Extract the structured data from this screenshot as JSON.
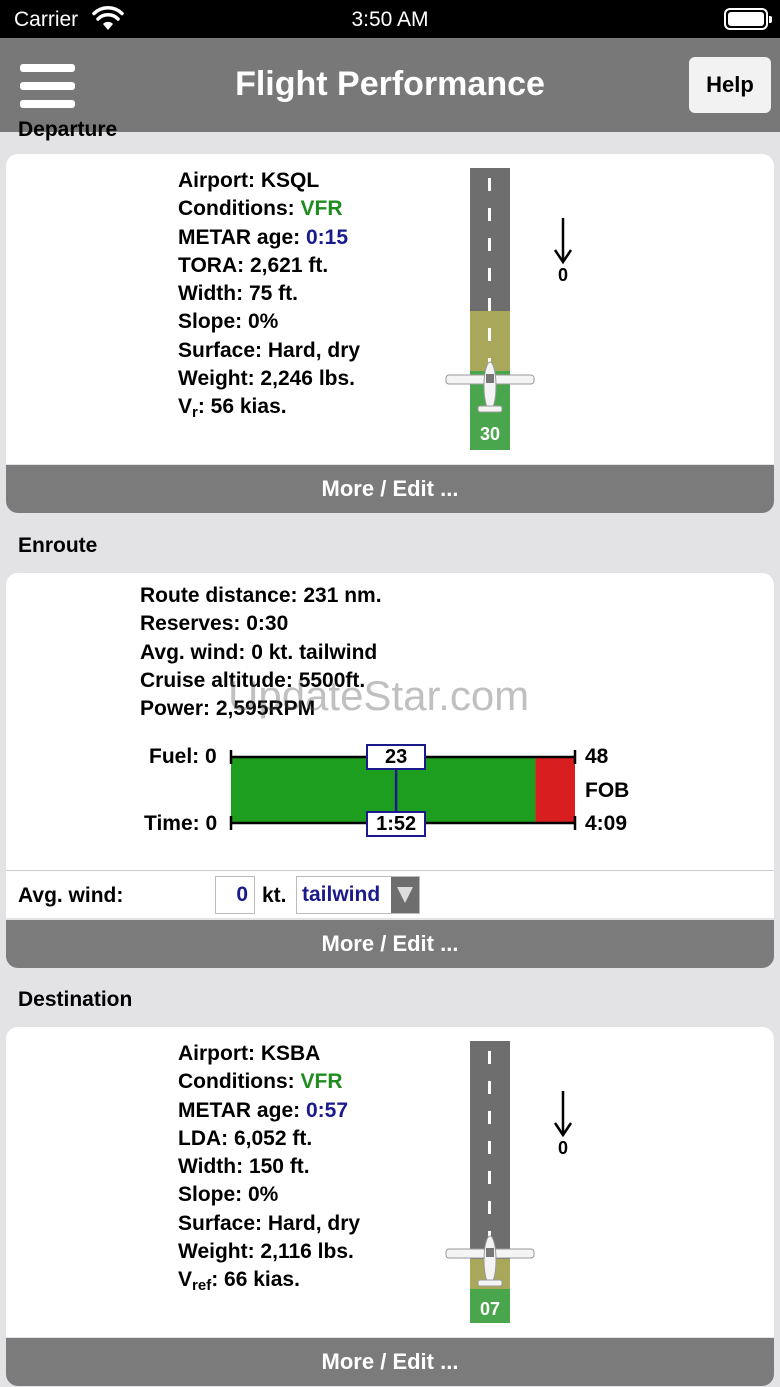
{
  "status_bar": {
    "carrier": "Carrier",
    "time": "3:50 AM"
  },
  "nav": {
    "title": "Flight Performance",
    "help_label": "Help"
  },
  "departure": {
    "section_label": "Departure",
    "airport_label": "Airport:",
    "airport": "KSQL",
    "conditions_label": "Conditions:",
    "conditions": "VFR",
    "metar_label": "METAR age:",
    "metar_age": "0:15",
    "tora": "TORA: 2,621 ft.",
    "width": "Width: 75 ft.",
    "slope": "Slope: 0%",
    "surface": "Surface: Hard, dry",
    "weight": "Weight: 2,246 lbs.",
    "v_main": "V",
    "v_sub": "r",
    "v_value": ": 56 kias.",
    "runway_number": "30",
    "wind_value": "0",
    "more_label": "More / Edit ..."
  },
  "enroute": {
    "section_label": "Enroute",
    "route_distance": "Route distance: 231 nm.",
    "reserves": "Reserves: 0:30",
    "avg_wind_text": "Avg. wind: 0 kt. tailwind",
    "cruise_altitude": "Cruise altitude: 5500ft.",
    "power": "Power: 2,595RPM",
    "fuel_label": "Fuel: 0",
    "time_label": "Time: 0",
    "fuel_marker": "23",
    "time_marker": "1:52",
    "fuel_end": "48",
    "fob_label": "FOB",
    "time_end": "4:09",
    "fuel_used_fraction": 0.48,
    "usable_fraction": 0.885,
    "colors": {
      "used": "#1e9e1e",
      "reserve": "#d81e1e"
    },
    "avg_wind_label": "Avg. wind:",
    "avg_wind_value": "0",
    "avg_wind_unit": "kt.",
    "wind_direction": "tailwind",
    "more_label": "More / Edit ..."
  },
  "destination": {
    "section_label": "Destination",
    "airport_label": "Airport:",
    "airport": "KSBA",
    "conditions_label": "Conditions:",
    "conditions": "VFR",
    "metar_label": "METAR age:",
    "metar_age": "0:57",
    "lda": "LDA: 6,052 ft.",
    "width": "Width: 150 ft.",
    "slope": "Slope: 0%",
    "surface": "Surface: Hard, dry",
    "weight": "Weight: 2,116 lbs.",
    "v_main": "V",
    "v_sub": "ref",
    "v_value": ": 66 kias.",
    "runway_number": "07",
    "wind_value": "0",
    "more_label": "More / Edit ..."
  },
  "watermark": "UpdateStar.com"
}
